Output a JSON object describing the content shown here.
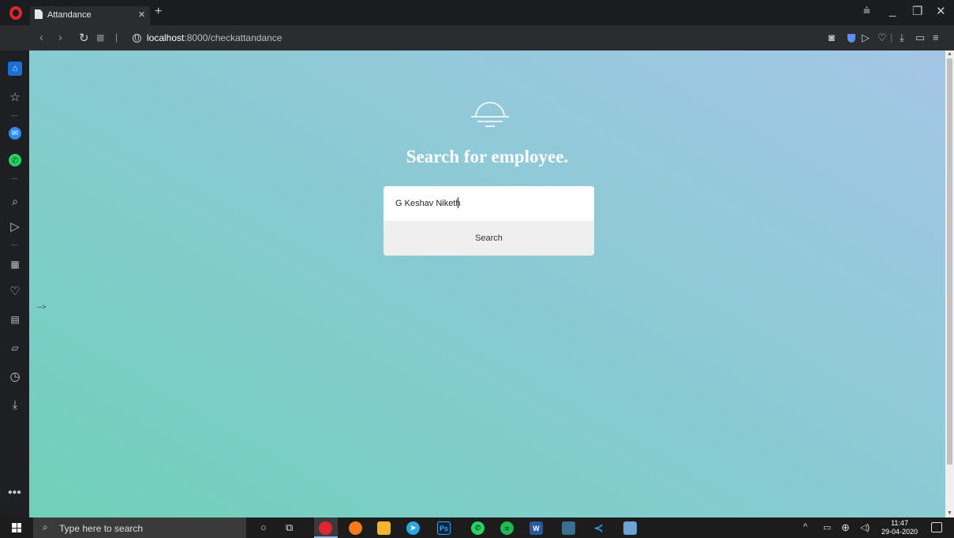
{
  "browser": {
    "tab_title": "Attandance",
    "tab_close": "×",
    "new_tab": "+",
    "url_host": "localhost",
    "url_rest": ":8000/checkattandance"
  },
  "page": {
    "stray_text": "-->",
    "heading": "Search for employee.",
    "search": {
      "value": "G Keshav Niketh",
      "button_label": "Search"
    }
  },
  "taskbar": {
    "search_placeholder": "Type here to search",
    "time": "11:47",
    "date": "29-04-2020"
  },
  "colors": {
    "opera_red": "#e0252f",
    "home_blue": "#1b6fd8",
    "gradient_start": "#6fd0b8",
    "gradient_end": "#a4c6e6"
  }
}
